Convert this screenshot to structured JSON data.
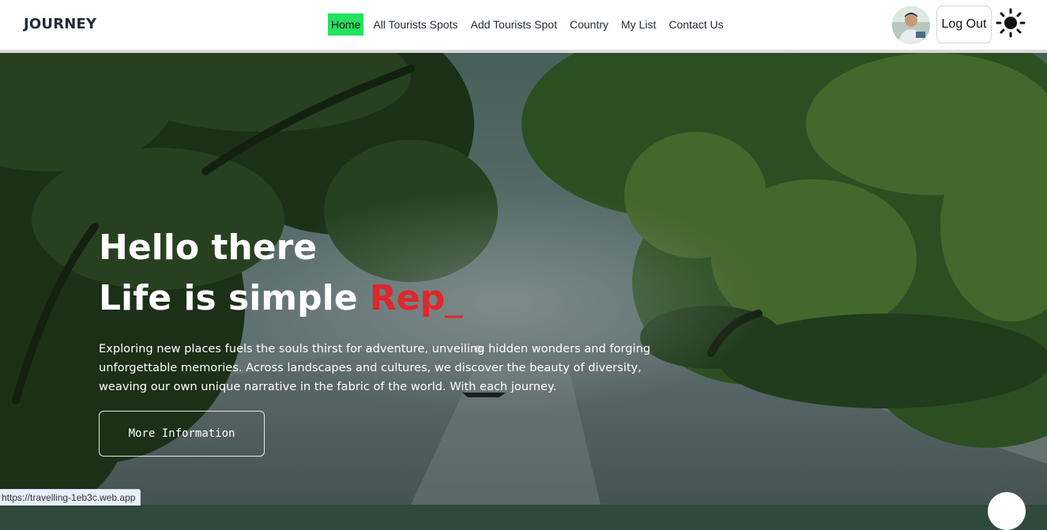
{
  "brand": "JOURNEY",
  "nav": {
    "items": [
      {
        "label": "Home",
        "active": true
      },
      {
        "label": "All Tourists Spots"
      },
      {
        "label": "Add Tourists Spot"
      },
      {
        "label": "Country"
      },
      {
        "label": "My List"
      },
      {
        "label": "Contact Us"
      }
    ],
    "logout_label": "Log Out",
    "theme_icon": "sun-icon"
  },
  "hero": {
    "title_line1": "Hello there",
    "title_line2_prefix": "Life is simple ",
    "typed_word": "Rep",
    "cursor": "_",
    "description": "Exploring new places fuels the souls thirst for adventure, unveiling hidden wonders and forging unforgettable memories. Across landscapes and cultures, we discover the beauty of diversity, weaving our own unique narrative in the fabric of the world. With each journey.",
    "button_label": "More Information"
  },
  "status_url": "https://travelling-1eb3c.web.app",
  "colors": {
    "active_nav": "#22e25f",
    "typed_word": "#e0262d"
  }
}
